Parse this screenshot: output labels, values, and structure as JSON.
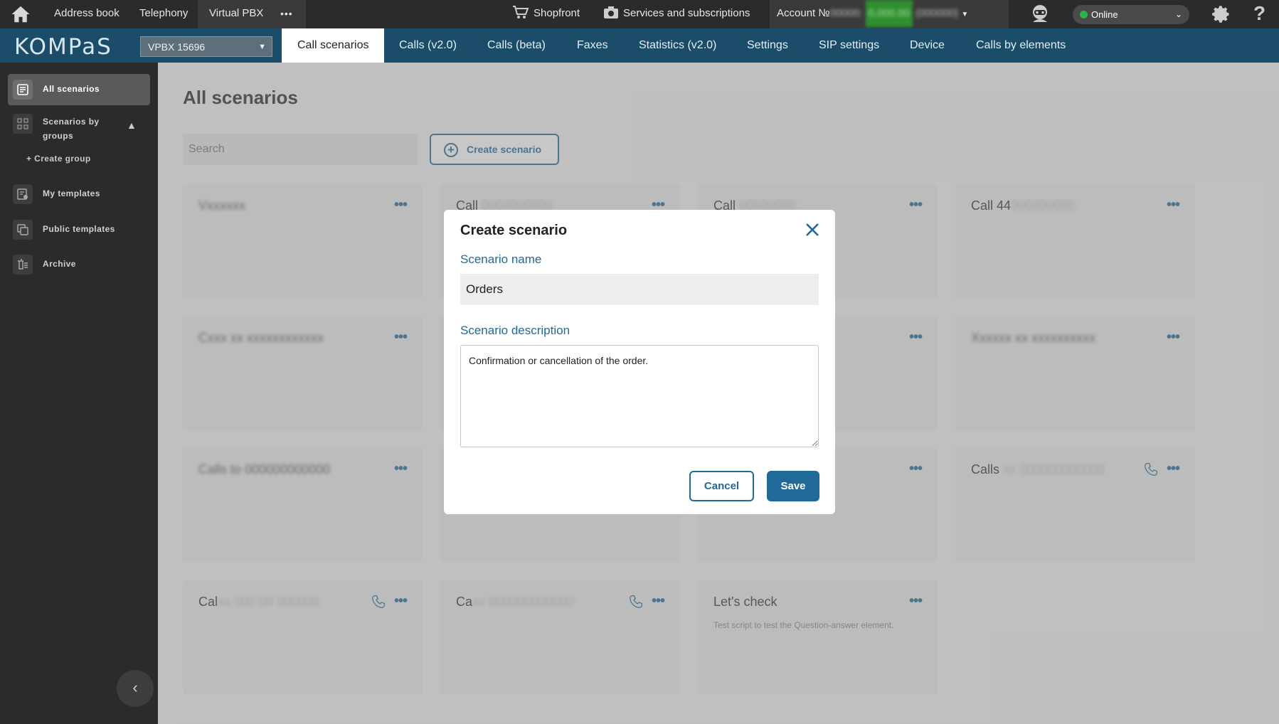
{
  "topbar": {
    "address_book": "Address book",
    "telephony": "Telephony",
    "virtual_pbx": "Virtual PBX",
    "more": "•••",
    "shopfront": "Shopfront",
    "services": "Services and subscriptions",
    "account_prefix": "Account №",
    "status": "Online"
  },
  "navbar": {
    "logo": "KOMPaS",
    "pbx_select": "VPBX 15696",
    "tabs": [
      "Call scenarios",
      "Calls (v2.0)",
      "Calls (beta)",
      "Faxes",
      "Statistics (v2.0)",
      "Settings",
      "SIP settings",
      "Device",
      "Calls by elements"
    ]
  },
  "sidebar": {
    "items": [
      {
        "label": "All scenarios"
      },
      {
        "label": "Scenarios by groups"
      },
      {
        "label": "My templates"
      },
      {
        "label": "Public templates"
      },
      {
        "label": "Archive"
      }
    ],
    "create_group": "+ Create group"
  },
  "main": {
    "title": "All scenarios",
    "search_placeholder": "Search",
    "create_button": "Create scenario",
    "cards": [
      {
        "title": "Call",
        "desc": ""
      },
      {
        "title": "Call",
        "desc": ""
      },
      {
        "title": "Call 44",
        "desc": ""
      },
      {
        "title": "Calls",
        "desc": ""
      },
      {
        "title": "Cal",
        "desc": ""
      },
      {
        "title": "Ca",
        "desc": ""
      },
      {
        "title": "Let's check",
        "desc": "Test script to test the Question-answer element."
      }
    ]
  },
  "modal": {
    "title": "Create scenario",
    "name_label": "Scenario name",
    "name_value": "Orders",
    "description_label": "Scenario description",
    "description_value": "Confirmation or cancellation of the order.",
    "cancel": "Cancel",
    "save": "Save"
  }
}
